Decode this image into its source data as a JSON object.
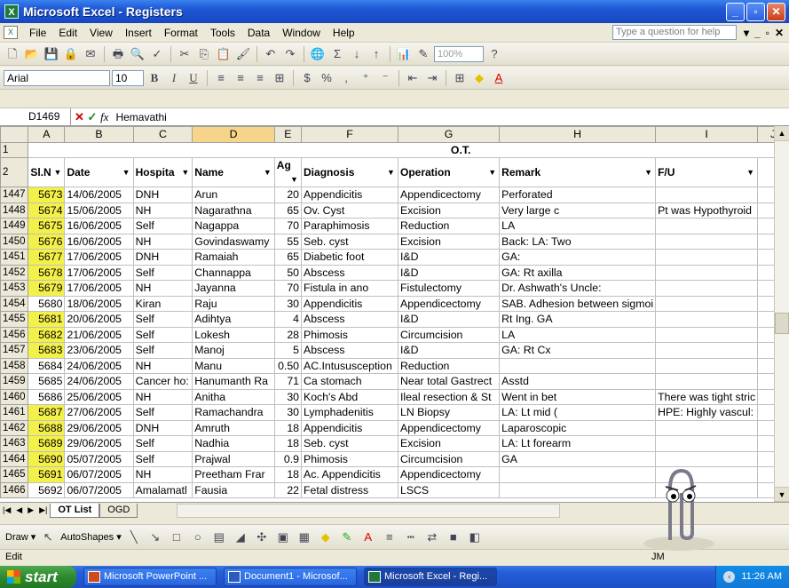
{
  "window": {
    "title": "Microsoft Excel - Registers",
    "minimize": "_",
    "maximize": "▫",
    "close": "✕"
  },
  "menubar": {
    "items": [
      "File",
      "Edit",
      "View",
      "Insert",
      "Format",
      "Tools",
      "Data",
      "Window",
      "Help"
    ],
    "ask_placeholder": "Type a question for help",
    "mdi_controls": [
      "▾",
      "_",
      "▫",
      "✕"
    ]
  },
  "toolbar": {
    "zoom": "100%"
  },
  "formatting": {
    "font": "Arial",
    "size": "10",
    "bold": "B",
    "italic": "I",
    "underline": "U"
  },
  "formula_bar": {
    "cell_ref": "D1469",
    "cancel": "✕",
    "enter": "✓",
    "fx": "fx",
    "value": "Hemavathi"
  },
  "sheet": {
    "columns": [
      "A",
      "B",
      "C",
      "D",
      "E",
      "F",
      "G",
      "H",
      "I",
      "J"
    ],
    "title_row_num": "1",
    "title": "O.T.",
    "header_row_num": "2",
    "headers": [
      "Sl.N",
      "Date",
      "Hospita",
      "Name",
      "Ag",
      "Diagnosis",
      "Operation",
      "Remark",
      "F/U",
      ""
    ],
    "rows": [
      {
        "n": "1447",
        "a": "5673",
        "hl": true,
        "b": "14/06/2005",
        "c": "DNH",
        "d": "Arun",
        "e": "20",
        "f": "Appendicitis",
        "g": "Appendicectomy",
        "h": "Perforated",
        "i": "",
        "j": ""
      },
      {
        "n": "1448",
        "a": "5674",
        "hl": true,
        "b": "15/06/2005",
        "c": "NH",
        "d": "Nagarathna",
        "e": "65",
        "f": "Ov. Cyst",
        "g": "Excision",
        "h": "Very large c",
        "i": "Pt was Hypothyroid",
        "j": ""
      },
      {
        "n": "1449",
        "a": "5675",
        "hl": true,
        "b": "16/06/2005",
        "c": "Self",
        "d": "Nagappa",
        "e": "70",
        "f": "Paraphimosis",
        "g": "Reduction",
        "h": "LA",
        "i": "",
        "j": ""
      },
      {
        "n": "1450",
        "a": "5676",
        "hl": true,
        "b": "16/06/2005",
        "c": "NH",
        "d": "Govindaswamy",
        "e": "55",
        "f": "Seb. cyst",
        "g": "Excision",
        "h": "Back: LA: Two",
        "i": "",
        "j": ""
      },
      {
        "n": "1451",
        "a": "5677",
        "hl": true,
        "b": "17/06/2005",
        "c": "DNH",
        "d": "Ramaiah",
        "e": "65",
        "f": "Diabetic foot",
        "g": "I&D",
        "h": "GA:",
        "i": "",
        "j": ""
      },
      {
        "n": "1452",
        "a": "5678",
        "hl": true,
        "b": "17/06/2005",
        "c": "Self",
        "d": "Channappa",
        "e": "50",
        "f": "Abscess",
        "g": "I&D",
        "h": "GA: Rt axilla",
        "i": "",
        "j": ""
      },
      {
        "n": "1453",
        "a": "5679",
        "hl": true,
        "b": "17/06/2005",
        "c": "NH",
        "d": "Jayanna",
        "e": "70",
        "f": "Fistula in ano",
        "g": "Fistulectomy",
        "h": "Dr. Ashwath's Uncle:",
        "i": "",
        "j": ""
      },
      {
        "n": "1454",
        "a": "5680",
        "hl": false,
        "b": "18/06/2005",
        "c": "Kiran",
        "d": "Raju",
        "e": "30",
        "f": "Appendicitis",
        "g": "Appendicectomy",
        "h": "SAB. Adhesion between sigmoi",
        "i": "",
        "j": ""
      },
      {
        "n": "1455",
        "a": "5681",
        "hl": true,
        "b": "20/06/2005",
        "c": "Self",
        "d": "Adihtya",
        "e": "4",
        "f": "Abscess",
        "g": "I&D",
        "h": "Rt Ing. GA",
        "i": "",
        "j": ""
      },
      {
        "n": "1456",
        "a": "5682",
        "hl": true,
        "b": "21/06/2005",
        "c": "Self",
        "d": "Lokesh",
        "e": "28",
        "f": "Phimosis",
        "g": "Circumcision",
        "h": "LA",
        "i": "",
        "j": ""
      },
      {
        "n": "1457",
        "a": "5683",
        "hl": true,
        "b": "23/06/2005",
        "c": "Self",
        "d": "Manoj",
        "e": "5",
        "f": "Abscess",
        "g": "I&D",
        "h": "GA: Rt Cx",
        "i": "",
        "j": ""
      },
      {
        "n": "1458",
        "a": "5684",
        "hl": false,
        "b": "24/06/2005",
        "c": "NH",
        "d": "Manu",
        "e": "0.50",
        "f": "AC.Intususception",
        "g": "Reduction",
        "h": "",
        "i": "",
        "j": ""
      },
      {
        "n": "1459",
        "a": "5685",
        "hl": false,
        "b": "24/06/2005",
        "c": "Cancer ho:",
        "d": "Hanumanth Ra",
        "e": "71",
        "f": "Ca stomach",
        "g": "Near total Gastrect",
        "h": "Asstd",
        "i": "",
        "j": ""
      },
      {
        "n": "1460",
        "a": "5686",
        "hl": false,
        "b": "25/06/2005",
        "c": "NH",
        "d": "Anitha",
        "e": "30",
        "f": "Koch's Abd",
        "g": "Ileal resection & St",
        "h": "Went in bet",
        "i": "There was tight stric",
        "j": ""
      },
      {
        "n": "1461",
        "a": "5687",
        "hl": true,
        "b": "27/06/2005",
        "c": "Self",
        "d": "Ramachandra",
        "e": "30",
        "f": "Lymphadenitis",
        "g": "LN Biopsy",
        "h": "LA: Lt mid (",
        "i": "HPE: Highly vascul:",
        "j": ""
      },
      {
        "n": "1462",
        "a": "5688",
        "hl": true,
        "b": "29/06/2005",
        "c": "DNH",
        "d": "Amruth",
        "e": "18",
        "f": "Appendicitis",
        "g": "Appendicectomy",
        "h": "Laparoscopic",
        "i": "",
        "j": ""
      },
      {
        "n": "1463",
        "a": "5689",
        "hl": true,
        "b": "29/06/2005",
        "c": "Self",
        "d": "Nadhia",
        "e": "18",
        "f": "Seb. cyst",
        "g": "Excision",
        "h": "LA: Lt forearm",
        "i": "",
        "j": ""
      },
      {
        "n": "1464",
        "a": "5690",
        "hl": true,
        "b": "05/07/2005",
        "c": "Self",
        "d": "Prajwal",
        "e": "0.9",
        "f": "Phimosis",
        "g": "Circumcision",
        "h": "GA",
        "i": "",
        "j": ""
      },
      {
        "n": "1465",
        "a": "5691",
        "hl": true,
        "b": "06/07/2005",
        "c": "NH",
        "d": "Preetham Frar",
        "e": "18",
        "f": "Ac. Appendicitis",
        "g": "Appendicectomy",
        "h": "",
        "i": "",
        "j": ""
      },
      {
        "n": "1466",
        "a": "5692",
        "hl": false,
        "b": "06/07/2005",
        "c": "Amalamatl",
        "d": "Fausia",
        "e": "22",
        "f": "Fetal distress",
        "g": "LSCS",
        "h": "",
        "i": "",
        "j": ""
      }
    ]
  },
  "tabs": [
    "OT List",
    "OGD"
  ],
  "drawbar": {
    "draw": "Draw ▾",
    "autoshapes": "AutoShapes ▾"
  },
  "status": {
    "mode": "Edit",
    "num": "JM"
  },
  "taskbar": {
    "start": "start",
    "tasks": [
      "Microsoft PowerPoint ...",
      "Document1 - Microsof...",
      "Microsoft Excel - Regi..."
    ],
    "clock": "11:26 AM"
  },
  "colors": {
    "highlight": "#f4f04a",
    "selected_header": "#f6d58b",
    "titlebar": "#1e56d4",
    "start": "#2d8a2d"
  }
}
